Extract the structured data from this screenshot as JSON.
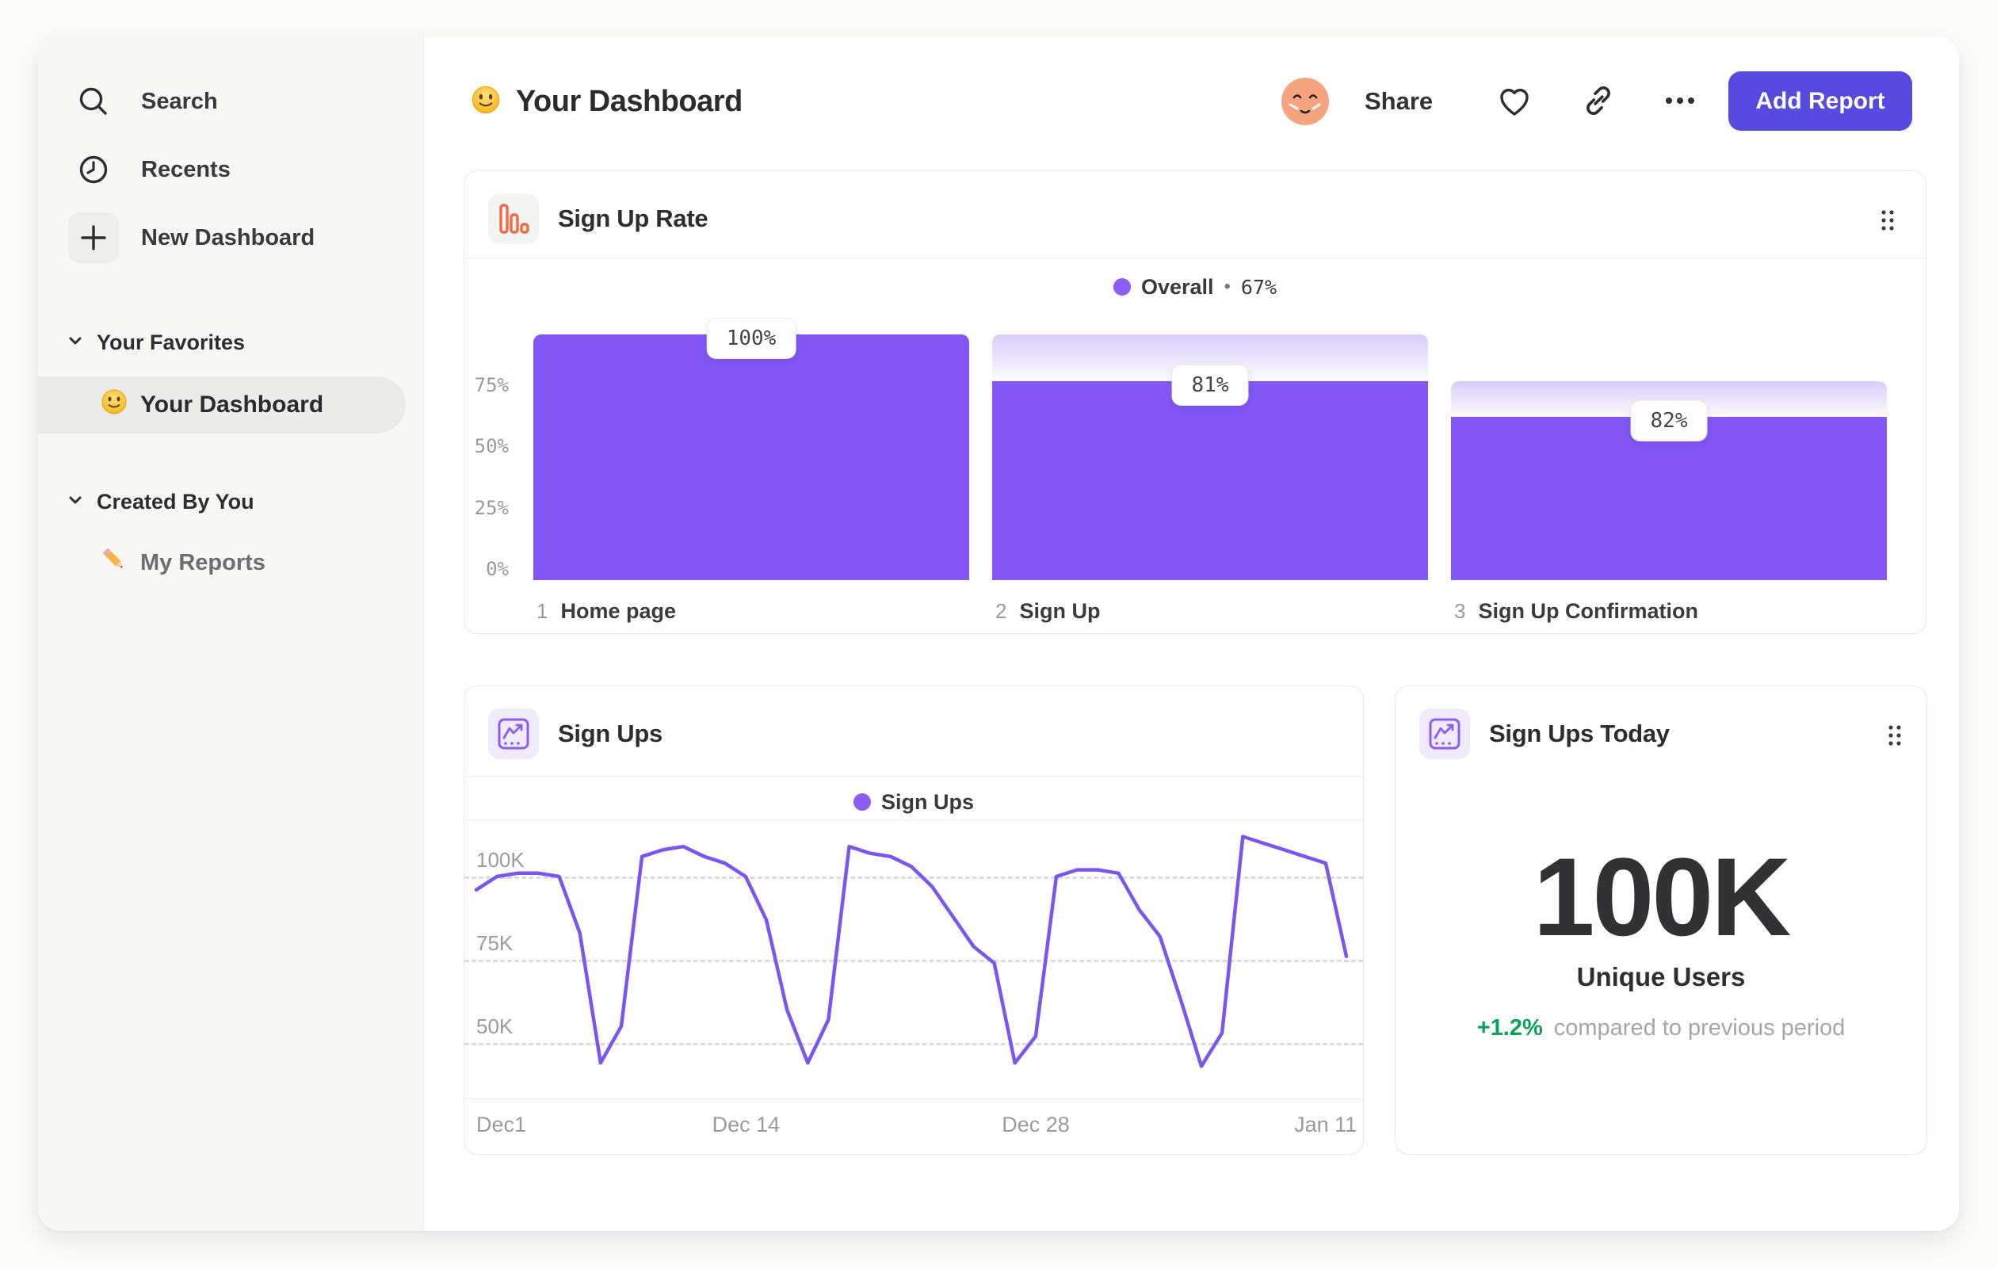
{
  "sidebar": {
    "search": "Search",
    "recents": "Recents",
    "new_dashboard": "New Dashboard",
    "favorites_header": "Your Favorites",
    "favorite_item": "Your Dashboard",
    "created_header": "Created By You",
    "created_item": "My Reports"
  },
  "header": {
    "title": "Your Dashboard",
    "share": "Share",
    "add_report": "Add Report"
  },
  "colors": {
    "bar_purple": "#8257F6",
    "line_purple": "#7B55EF",
    "legend_dot": "#8B5CF6",
    "button": "#574AE0",
    "accent_orange": "#F26843",
    "green": "#0BA15A"
  },
  "chart_data": [
    {
      "type": "bar",
      "variant": "funnel",
      "title": "Sign Up Rate",
      "legend_series": "Overall",
      "legend_sep": "•",
      "legend_value": "67%",
      "categories": [
        "Home page",
        "Sign Up",
        "Sign Up Confirmation"
      ],
      "category_numbers": [
        "1",
        "2",
        "3"
      ],
      "values": [
        100,
        81,
        82
      ],
      "bar_labels": [
        "100%",
        "81%",
        "82%"
      ],
      "yticks": [
        {
          "label": "75%",
          "value": 75
        },
        {
          "label": "50%",
          "value": 50
        },
        {
          "label": "25%",
          "value": 25
        },
        {
          "label": "0%",
          "value": 0
        }
      ],
      "ylim": [
        0,
        100
      ],
      "grid": false,
      "legend_position": "top-center",
      "bar_color": "#8257F6",
      "fade_top_color": "rgba(130,87,246,0.30)",
      "fade_bottom_color": "rgba(130,87,246,0.02)"
    },
    {
      "type": "line",
      "title": "Sign Ups",
      "legend_series": "Sign Ups",
      "unit": "K",
      "values": [
        96,
        100,
        101,
        101,
        100,
        83,
        44,
        55,
        106,
        108,
        109,
        106,
        104,
        100,
        87,
        60,
        44,
        57,
        109,
        107,
        106,
        103,
        97,
        88,
        79,
        74,
        44,
        52,
        100,
        102,
        102,
        101,
        90,
        82,
        63,
        43,
        53,
        112,
        110,
        108,
        106,
        104,
        76
      ],
      "yticks": [
        {
          "label": "100K",
          "value": 100
        },
        {
          "label": "75K",
          "value": 75
        },
        {
          "label": "50K",
          "value": 50
        }
      ],
      "x_ticks": [
        {
          "label": "Dec1",
          "frac": 0.0
        },
        {
          "label": "Dec 14",
          "frac": 0.31
        },
        {
          "label": "Dec 28",
          "frac": 0.643
        },
        {
          "label": "Jan 11",
          "frac": 0.976
        }
      ],
      "ylim": [
        33,
        115
      ],
      "grid": true,
      "legend_position": "top-center",
      "line_color": "#7B55EF"
    },
    {
      "type": "metric",
      "title": "Sign Ups Today",
      "value": "100K",
      "label": "Unique Users",
      "delta": "+1.2%",
      "note": "compared to previous period"
    }
  ]
}
